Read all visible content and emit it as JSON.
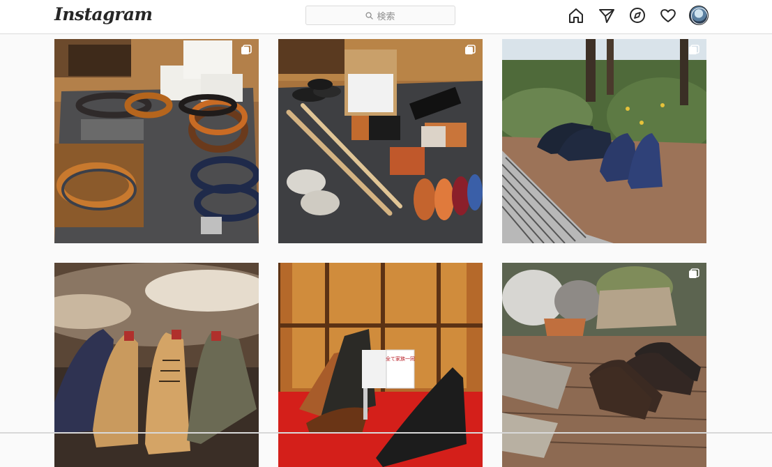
{
  "header": {
    "logo": "Instagram",
    "search": {
      "placeholder": "検索"
    },
    "nav": [
      "home-icon",
      "direct-message-icon",
      "explore-icon",
      "activity-heart-icon",
      "profile-avatar"
    ]
  },
  "colors": {
    "border": "#dbdbdb",
    "text": "#262626",
    "muted": "#8e8e8e",
    "background": "#fafafa"
  },
  "posts": [
    {
      "subject": "leather belts display",
      "multiple": true
    },
    {
      "subject": "shoe care kit and shoehorns",
      "multiple": true
    },
    {
      "subject": "navy suede chukka boots on stone path",
      "multiple": true
    },
    {
      "subject": "row of suede derby shoes",
      "multiple": false
    },
    {
      "subject": "black and brown leather shoes with sign",
      "multiple": false
    },
    {
      "subject": "dark brown suede wingtip shoes on bricks",
      "multiple": true
    }
  ],
  "sign_text": "全て家族一同"
}
